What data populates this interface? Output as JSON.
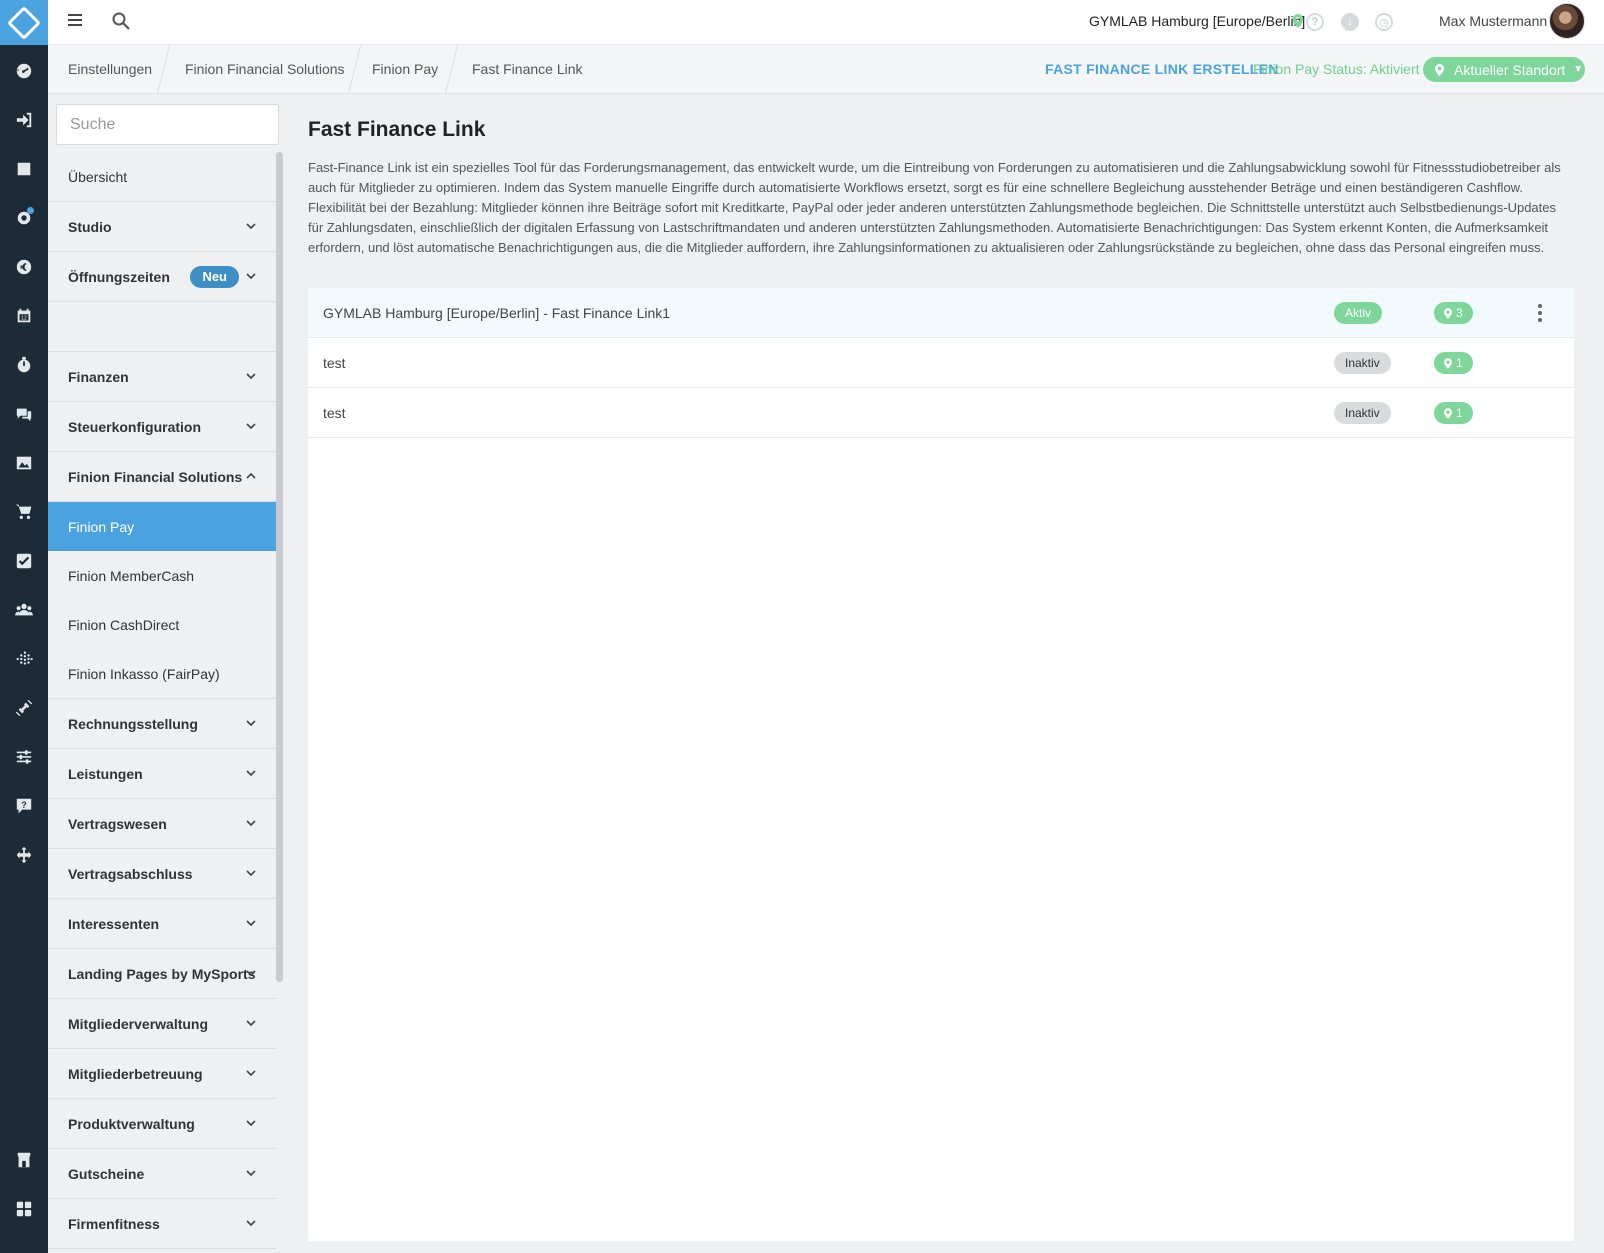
{
  "topbar": {
    "location": "GYMLAB Hamburg [Europe/Berlin]",
    "user_name": "Max Mustermann",
    "help_symbol": "?",
    "icons": [
      "menu-icon",
      "search-icon",
      "location-pin-icon",
      "help-icon",
      "download-icon",
      "clock-icon",
      "avatar"
    ]
  },
  "breadcrumb": {
    "items": [
      "Einstellungen",
      "Finion Financial Solutions",
      "Finion Pay",
      "Fast Finance Link"
    ]
  },
  "actions": {
    "create_label": "FAST FINANCE LINK ERSTELLEN",
    "status_label": "Finion Pay Status: Aktiviert",
    "standort_label": "Aktueller Standort"
  },
  "sidebar": {
    "search_placeholder": "Suche",
    "items": [
      {
        "label": "Übersicht"
      },
      {
        "label": "Studio"
      },
      {
        "label": "Öffnungszeiten",
        "badge": "Neu"
      },
      {
        "label": ""
      },
      {
        "label": "Finanzen"
      },
      {
        "label": "Steuerkonfiguration"
      },
      {
        "label": "Finion Financial Solutions"
      },
      {
        "label": "Finion Pay"
      },
      {
        "label": "Finion MemberCash"
      },
      {
        "label": "Finion CashDirect"
      },
      {
        "label": "Finion Inkasso (FairPay)"
      },
      {
        "label": "Rechnungsstellung"
      },
      {
        "label": "Leistungen"
      },
      {
        "label": "Vertragswesen"
      },
      {
        "label": "Vertragsabschluss"
      },
      {
        "label": "Interessenten"
      },
      {
        "label": "Landing Pages by MySports"
      },
      {
        "label": "Mitgliederverwaltung"
      },
      {
        "label": "Mitgliederbetreuung"
      },
      {
        "label": "Produktverwaltung"
      },
      {
        "label": "Gutscheine"
      },
      {
        "label": "Firmenfitness"
      }
    ]
  },
  "main": {
    "title": "Fast Finance Link",
    "description": "Fast-Finance Link ist ein spezielles Tool für das Forderungsmanagement, das entwickelt wurde, um die Eintreibung von Forderungen zu automatisieren und die Zahlungsabwicklung sowohl für Fitnessstudiobetreiber als auch für Mitglieder zu optimieren. Indem das System manuelle Eingriffe durch automatisierte Workflows ersetzt, sorgt es für eine schnellere Begleichung ausstehender Beträge und einen beständigeren Cashflow. Flexibilität bei der Bezahlung: Mitglieder können ihre Beiträge sofort mit Kreditkarte, PayPal oder jeder anderen unterstützten Zahlungsmethode begleichen. Die Schnittstelle unterstützt auch Selbstbedienungs-Updates für Zahlungsdaten, einschließlich der digitalen Erfassung von Lastschriftmandaten und anderen unterstützten Zahlungsmethoden. Automatisierte Benachrichtigungen: Das System erkennt Konten, die Aufmerksamkeit erfordern, und löst automatische Benachrichtigungen aus, die die Mitglieder auffordern, ihre Zahlungsinformationen zu aktualisieren oder Zahlungsrückstände zu begleichen, ohne dass das Personal eingreifen muss.",
    "rows": [
      {
        "name": "GYMLAB Hamburg [Europe/Berlin] - Fast Finance Link1",
        "status": "Aktiv",
        "locations": "3"
      },
      {
        "name": "test",
        "status": "Inaktiv",
        "locations": "1"
      },
      {
        "name": "test",
        "status": "Inaktiv",
        "locations": "1"
      }
    ]
  },
  "colors": {
    "accent": "#4aa3df",
    "rail": "#1c2b36",
    "success": "#7ed69a",
    "badge": "#3d8fc6"
  }
}
